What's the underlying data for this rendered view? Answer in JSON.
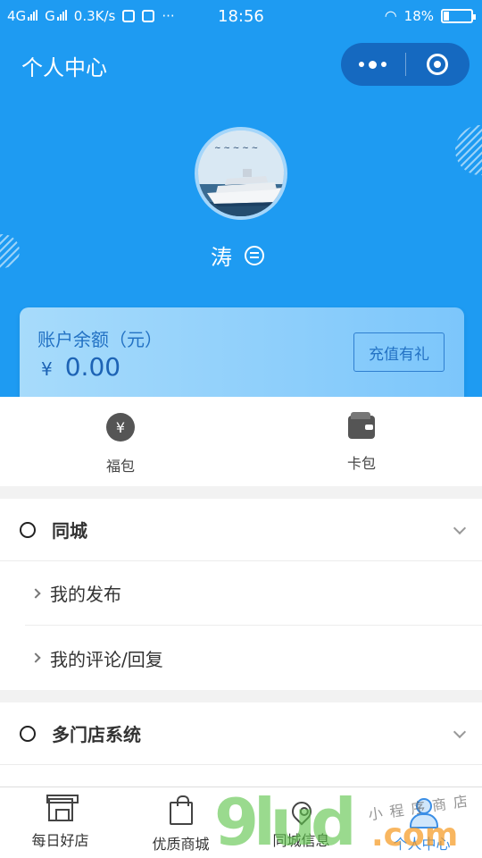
{
  "status_bar": {
    "network1": "4G",
    "network2": "G",
    "speed": "0.3K/s",
    "time": "18:56",
    "battery": "18%",
    "battery_level": 0.18
  },
  "header": {
    "title": "个人中心"
  },
  "profile": {
    "username": "涛"
  },
  "balance": {
    "label": "账户余额（元）",
    "currency": "¥",
    "amount": "0.00",
    "recharge_label": "充值有礼"
  },
  "wallet": {
    "items": [
      {
        "label": "福包",
        "icon": "red-packet-icon",
        "glyph": "¥"
      },
      {
        "label": "卡包",
        "icon": "wallet-icon"
      }
    ]
  },
  "sections": [
    {
      "title": "同城",
      "items": [
        {
          "label": "我的发布"
        },
        {
          "label": "我的评论/回复"
        }
      ]
    },
    {
      "title": "多门店系统",
      "items": []
    }
  ],
  "tab_bar": {
    "items": [
      {
        "label": "每日好店",
        "icon": "shop-icon"
      },
      {
        "label": "优质商城",
        "icon": "shopping-bag-icon"
      },
      {
        "label": "同城信息",
        "icon": "location-pin-icon"
      },
      {
        "label": "个人中心",
        "icon": "person-icon",
        "active": true
      }
    ]
  },
  "watermark": {
    "main": "9lud",
    "sub": "小程序商店",
    "domain": ".com"
  },
  "colors": {
    "header_bg": "#1e9bf2",
    "capsule_bg": "#1569c0",
    "balance_text": "#1d63b5",
    "active_tab": "#3a8ee6"
  }
}
